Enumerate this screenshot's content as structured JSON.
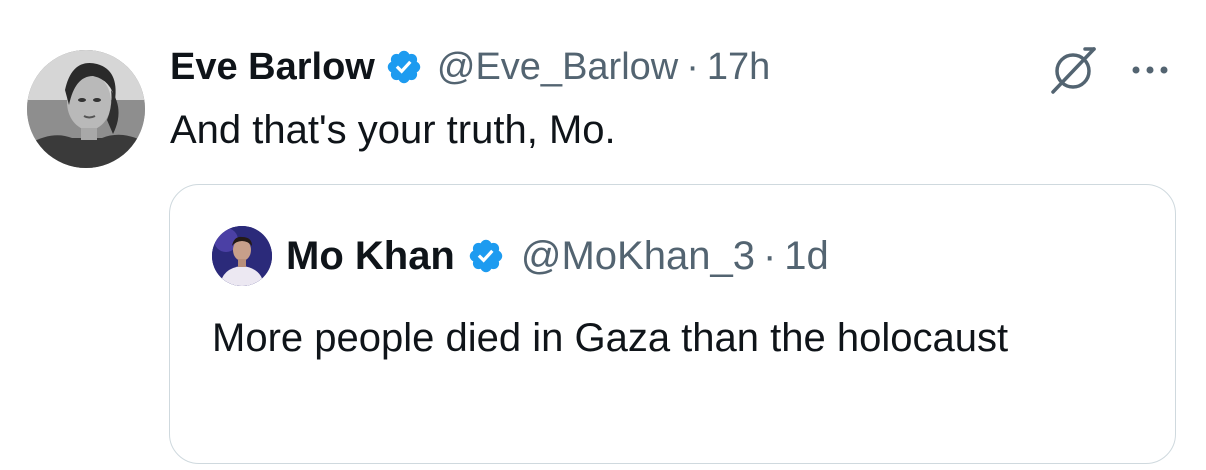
{
  "tweet": {
    "display_name": "Eve Barlow",
    "handle": "@Eve_Barlow",
    "separator": "·",
    "time": "17h",
    "text": "And that's your truth, Mo."
  },
  "quoted_tweet": {
    "display_name": "Mo Khan",
    "handle": "@MoKhan_3",
    "separator": "·",
    "time": "1d",
    "text": "More people died in Gaza than the holocaust"
  },
  "icons": {
    "verified": "verified-badge-icon",
    "grok": "grok-icon",
    "more": "more-options-icon"
  },
  "colors": {
    "verified_blue": "#1d9bf0",
    "secondary_text": "#536471",
    "border": "#cfd9de"
  }
}
